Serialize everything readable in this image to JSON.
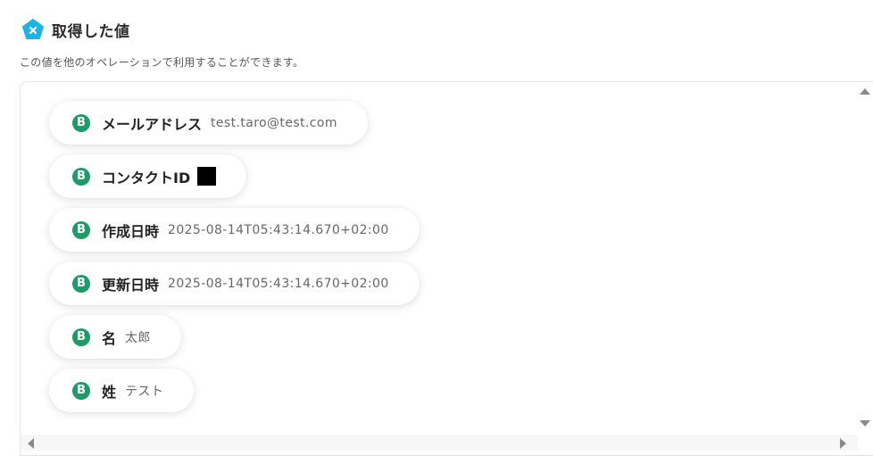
{
  "header": {
    "title": "取得した値",
    "icon": "x-pentagon-icon",
    "icon_color": "#1cb3e6"
  },
  "description": "この値を他のオペレーションで利用することができます。",
  "fields": [
    {
      "badge": "B",
      "label": "メールアドレス",
      "value": "test.taro@test.com"
    },
    {
      "badge": "B",
      "label": "コンタクトID",
      "value": ""
    },
    {
      "badge": "B",
      "label": "作成日時",
      "value": "2025-08-14T05:43:14.670+02:00"
    },
    {
      "badge": "B",
      "label": "更新日時",
      "value": "2025-08-14T05:43:14.670+02:00"
    },
    {
      "badge": "B",
      "label": "名",
      "value": "太郎"
    },
    {
      "badge": "B",
      "label": "姓",
      "value": "テスト"
    }
  ],
  "colors": {
    "badge": "#1f9b68",
    "accent": "#1cb3e6"
  }
}
